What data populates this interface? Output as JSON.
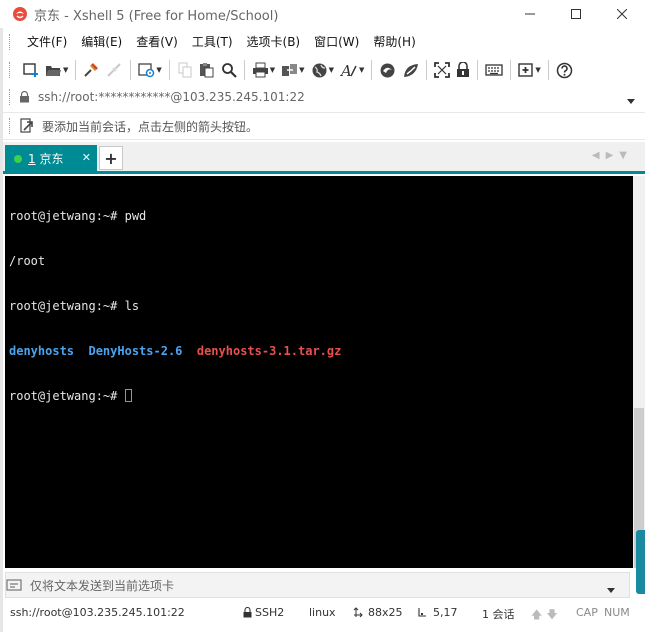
{
  "window": {
    "title": "京东 - Xshell 5 (Free for Home/School)",
    "accent_color": "#008a94"
  },
  "menu": {
    "items": [
      "文件(F)",
      "编辑(E)",
      "查看(V)",
      "工具(T)",
      "选项卡(B)",
      "窗口(W)",
      "帮助(H)"
    ]
  },
  "address": {
    "value": "ssh://root:************@103.235.245.101:22"
  },
  "hint": {
    "text": "要添加当前会话，点击左侧的箭头按钮。"
  },
  "tabs": {
    "active": {
      "number": "1",
      "label": "京东"
    }
  },
  "terminal": {
    "prompt": "root@jetwang:~#",
    "lines": [
      {
        "prompt": "root@jetwang:~#",
        "command": " pwd"
      },
      {
        "output": "/root"
      },
      {
        "prompt": "root@jetwang:~#",
        "command": " ls"
      },
      {
        "items": [
          "denyhosts",
          "DenyHosts-2.6",
          "denyhosts-3.1.tar.gz"
        ]
      },
      {
        "prompt": "root@jetwang:~#",
        "command": " "
      }
    ]
  },
  "compose": {
    "placeholder": "仅将文本发送到当前选项卡"
  },
  "status": {
    "connection": "ssh://root@103.235.245.101:22",
    "protocol": "SSH2",
    "term_type": "linux",
    "size": "88x25",
    "cursor_pos": "5,17",
    "sessions": "1 会话",
    "cap": "CAP",
    "num": "NUM"
  }
}
